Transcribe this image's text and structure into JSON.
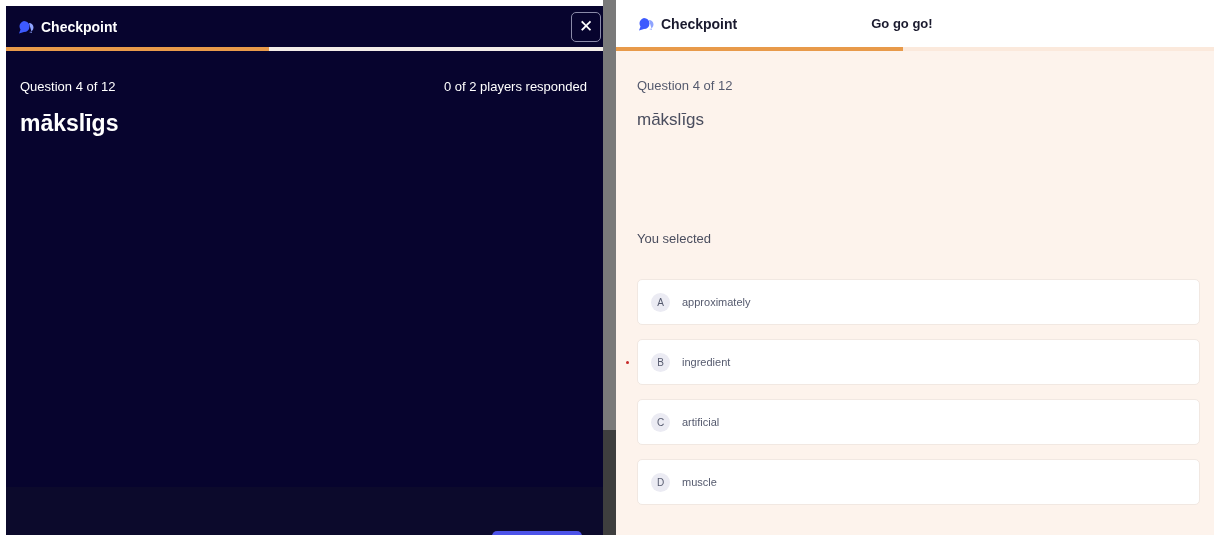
{
  "host": {
    "brand": "Checkpoint",
    "progress": {
      "level": 0.44
    },
    "question_counter": "Question 4 of 12",
    "responses": "0 of 2 players responded",
    "word": "mākslīgs",
    "close_label": "✕"
  },
  "player": {
    "brand": "Checkpoint",
    "message": "Go go go!",
    "progress": {
      "level": 0.48
    },
    "question_counter": "Question 4 of 12",
    "word": "mākslīgs",
    "prompt": "You selected",
    "options": [
      {
        "letter": "A",
        "text": "approximately",
        "marked": false
      },
      {
        "letter": "B",
        "text": "ingredient",
        "marked": true
      },
      {
        "letter": "C",
        "text": "artificial",
        "marked": false
      },
      {
        "letter": "D",
        "text": "muscle",
        "marked": false
      }
    ]
  }
}
